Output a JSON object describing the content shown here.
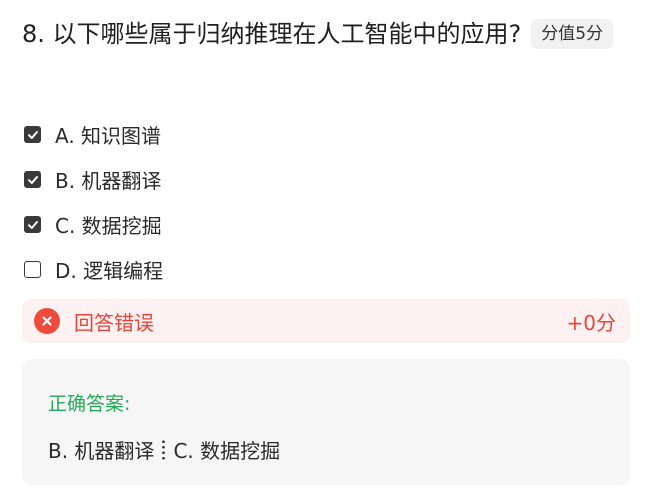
{
  "question": {
    "text": "8. 以下哪些属于归纳推理在人工智能中的应用?",
    "score_label": "分值5分"
  },
  "options": [
    {
      "label": "A. 知识图谱",
      "checked": true
    },
    {
      "label": "B. 机器翻译",
      "checked": true
    },
    {
      "label": "C. 数据挖掘",
      "checked": true
    },
    {
      "label": "D. 逻辑编程",
      "checked": false
    }
  ],
  "result": {
    "status": "回答错误",
    "score": "+0分",
    "color": "#e8443a",
    "icon": "close-circle-icon"
  },
  "answer": {
    "title": "正确答案:",
    "items": [
      "B. 机器翻译",
      "C. 数据挖掘"
    ],
    "title_color": "#28a85a"
  }
}
